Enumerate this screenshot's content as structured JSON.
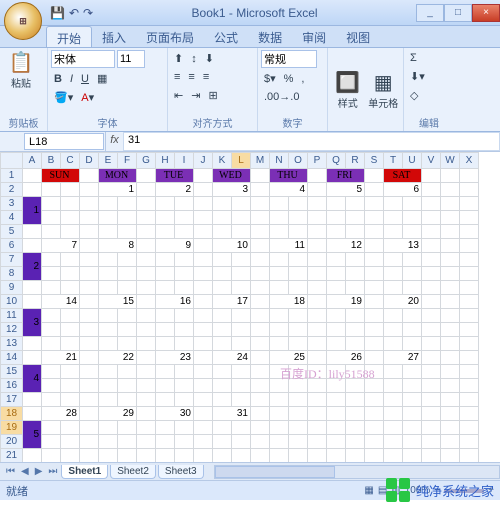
{
  "window": {
    "title": "Book1 - Microsoft Excel",
    "min": "_",
    "max": "□",
    "close": "×"
  },
  "qat": {
    "save": "💾",
    "undo": "↶",
    "redo": "↷"
  },
  "tabs": {
    "home": "开始",
    "insert": "插入",
    "layout": "页面布局",
    "formulas": "公式",
    "data": "数据",
    "review": "审阅",
    "view": "视图"
  },
  "ribbon": {
    "clipboard": {
      "paste": "粘贴",
      "label": "剪贴板"
    },
    "font": {
      "name": "宋体",
      "size": "11",
      "label": "字体",
      "bold": "B",
      "italic": "I",
      "underline": "U"
    },
    "align": {
      "label": "对齐方式",
      "wrap": "≡",
      "merge": "⊞"
    },
    "number": {
      "format": "常规",
      "label": "数字",
      "pct": "%",
      "comma": ","
    },
    "styles": {
      "style": "样式",
      "cells": "单元格"
    },
    "editing": {
      "sum": "Σ",
      "clear": "◇",
      "label": "编辑"
    }
  },
  "namebox": "L18",
  "formula": "31",
  "columns": [
    "A",
    "B",
    "C",
    "D",
    "E",
    "F",
    "G",
    "H",
    "I",
    "J",
    "K",
    "L",
    "M",
    "N",
    "O",
    "P",
    "Q",
    "R",
    "S",
    "T",
    "U",
    "V",
    "W",
    "X"
  ],
  "rows_count": 21,
  "dayHeaders": {
    "SUN": {
      "col": 2,
      "span": 2,
      "cls": "day-hdr-red"
    },
    "MON": {
      "col": 5,
      "span": 2,
      "cls": "day-hdr-pur"
    },
    "TUE": {
      "col": 8,
      "span": 2,
      "cls": "day-hdr-pur"
    },
    "WED": {
      "col": 11,
      "span": 2,
      "cls": "day-hdr-pur"
    },
    "THU": {
      "col": 14,
      "span": 2,
      "cls": "day-hdr-pur"
    },
    "FRI": {
      "col": 17,
      "span": 2,
      "cls": "day-hdr-pur"
    },
    "SAT": {
      "col": 20,
      "span": 2,
      "cls": "day-hdr-red"
    }
  },
  "weeknums": {
    "1": 3,
    "2": 7,
    "3": 11,
    "4": 15,
    "5": 19
  },
  "dates": [
    {
      "row": 2,
      "vals": {
        "5": 1,
        "8": 2,
        "11": 3,
        "14": 4,
        "17": 5,
        "20": 6
      }
    },
    {
      "row": 6,
      "vals": {
        "2": 7,
        "5": 8,
        "8": 9,
        "11": 10,
        "14": 11,
        "17": 12,
        "20": 13
      }
    },
    {
      "row": 10,
      "vals": {
        "2": 14,
        "5": 15,
        "8": 16,
        "11": 17,
        "14": 18,
        "17": 19,
        "20": 20
      }
    },
    {
      "row": 14,
      "vals": {
        "2": 21,
        "5": 22,
        "8": 23,
        "11": 24,
        "14": 25,
        "17": 26,
        "20": 27
      }
    },
    {
      "row": 18,
      "vals": {
        "2": 28,
        "5": 29,
        "8": 30,
        "11": 31
      }
    }
  ],
  "activeCell": {
    "row": 18,
    "col": "L"
  },
  "selCol": "L",
  "selRows": [
    18,
    19
  ],
  "watermark": "百度ID：lily51588",
  "sheets": {
    "nav": [
      "⏮",
      "◀",
      "▶",
      "⏭"
    ],
    "s1": "Sheet1",
    "s2": "Sheet2",
    "s3": "Sheet3"
  },
  "status": {
    "ready": "就绪",
    "zoom": "100%"
  },
  "brand": "纯净系统之家"
}
